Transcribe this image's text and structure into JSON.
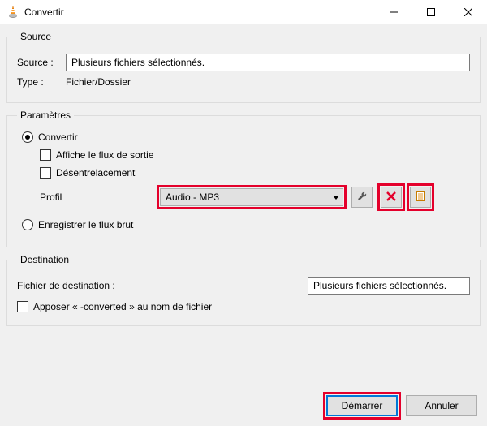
{
  "window": {
    "title": "Convertir"
  },
  "source_group": {
    "legend": "Source",
    "source_label": "Source :",
    "source_value": "Plusieurs fichiers sélectionnés.",
    "type_label": "Type :",
    "type_value": "Fichier/Dossier"
  },
  "settings_group": {
    "legend": "Paramètres",
    "convert_label": "Convertir",
    "show_output_label": "Affiche le flux de sortie",
    "deinterlace_label": "Désentrelacement",
    "profile_label": "Profil",
    "profile_value": "Audio - MP3",
    "dump_raw_label": "Enregistrer le flux brut"
  },
  "destination_group": {
    "legend": "Destination",
    "dest_file_label": "Fichier de destination :",
    "dest_file_value": "Plusieurs fichiers sélectionnés.",
    "append_label": "Apposer « -converted » au nom de fichier"
  },
  "footer": {
    "start_label": "Démarrer",
    "cancel_label": "Annuler"
  }
}
